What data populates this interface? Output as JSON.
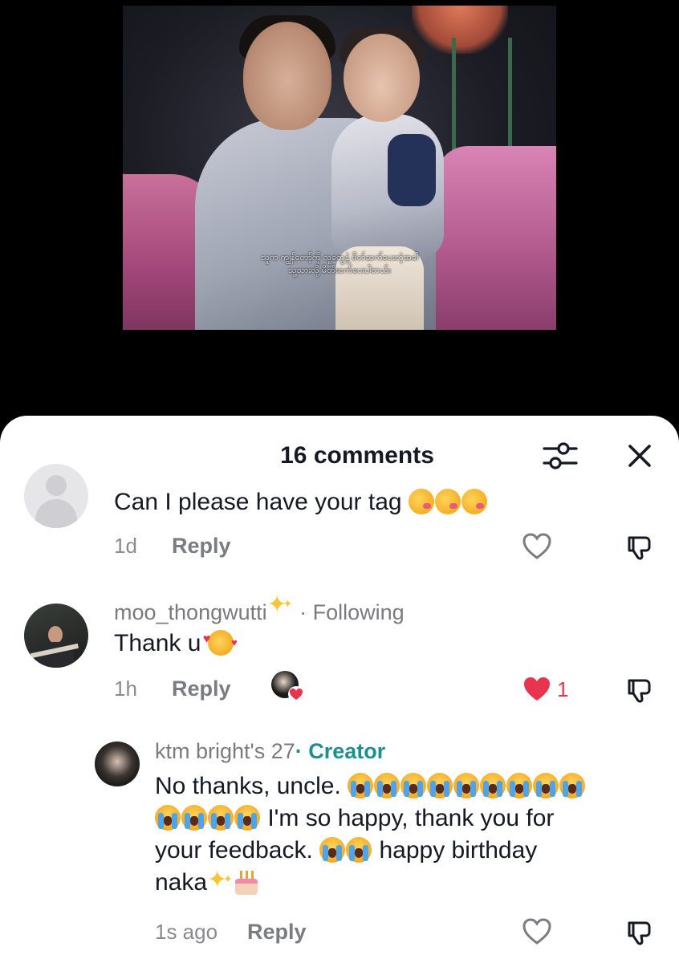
{
  "video": {
    "caption_line1": "သူက ကျွန်တော့်ကို လူတွေနဲ့ မိတ်ဆက်ပေးတဲ့အခါ",
    "caption_line2": "သူ့သားလို့ မိတ်ဆက်ပေးပါတယ်။"
  },
  "sheet": {
    "title": "16 comments",
    "filter_icon": "filter-sliders-icon",
    "close_icon": "close-icon"
  },
  "comments": [
    {
      "username": "",
      "text": "Can I please have your tag",
      "emojis": [
        "woozy-face",
        "woozy-face",
        "woozy-face"
      ],
      "time": "1d",
      "reply_label": "Reply"
    },
    {
      "username": "moo_thongwutti",
      "username_emoji": "sparkles",
      "relation": "· Following",
      "text": "Thank u",
      "emojis": [
        "smiling-face-with-hearts"
      ],
      "time": "1h",
      "reply_label": "Reply",
      "liked_by_creator": true,
      "like_count": "1",
      "liked": true
    },
    {
      "username": "ktm bright's 27",
      "badge": "· Creator",
      "text_part1": "No thanks, uncle.",
      "text_part2": "I'm so happy, thank you for",
      "text_part3": "your feedback.",
      "text_part4": "happy birthday",
      "text_part5": "naka",
      "time": "1s ago",
      "reply_label": "Reply",
      "is_reply": true
    }
  ],
  "colors": {
    "accent_like": "#e8344f",
    "creator_badge": "#1e8f8f",
    "text_primary": "#161823",
    "text_secondary": "#8a8b91"
  }
}
